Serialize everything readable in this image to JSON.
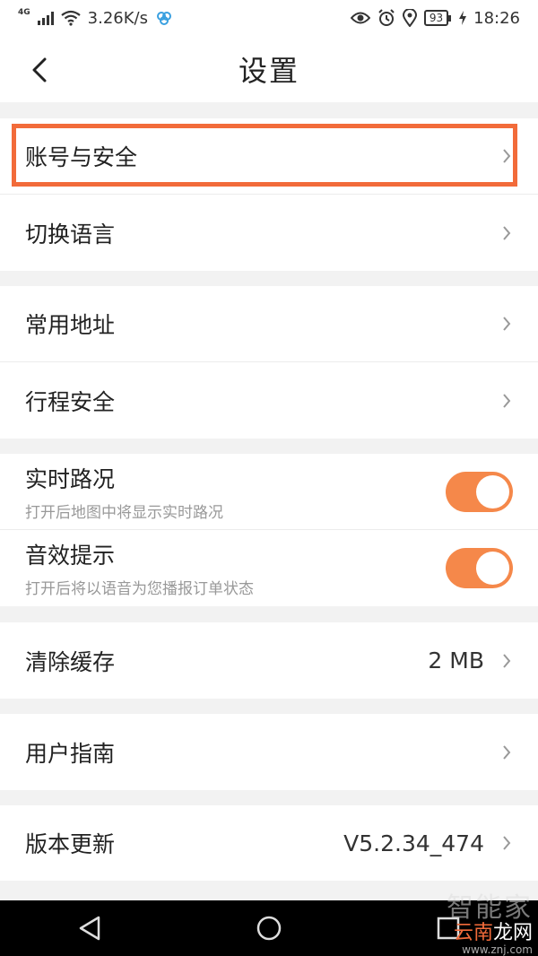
{
  "status_bar": {
    "network": "4G",
    "speed": "3.26K/s",
    "battery": "93",
    "time": "18:26"
  },
  "header": {
    "title": "设置",
    "back_icon": "chevron-left-icon"
  },
  "groups": [
    {
      "items": [
        {
          "label": "账号与安全"
        },
        {
          "label": "切换语言"
        }
      ]
    },
    {
      "items": [
        {
          "label": "常用地址"
        },
        {
          "label": "行程安全"
        }
      ]
    },
    {
      "items": [
        {
          "label": "实时路况",
          "sub": "打开后地图中将显示实时路况",
          "toggle": true
        },
        {
          "label": "音效提示",
          "sub": "打开后将以语音为您播报订单状态",
          "toggle": true
        }
      ]
    },
    {
      "items": [
        {
          "label": "清除缓存",
          "value": "2 MB"
        }
      ]
    },
    {
      "items": [
        {
          "label": "用户指南"
        }
      ]
    },
    {
      "items": [
        {
          "label": "版本更新",
          "value": "V5.2.34_474"
        }
      ]
    }
  ],
  "colors": {
    "accent": "#f5884a",
    "highlight": "#f26b3a"
  },
  "watermark": {
    "line1": "智能家",
    "line2_a": "云南",
    "line2_b": "龙网",
    "url": "www.znj.com"
  }
}
